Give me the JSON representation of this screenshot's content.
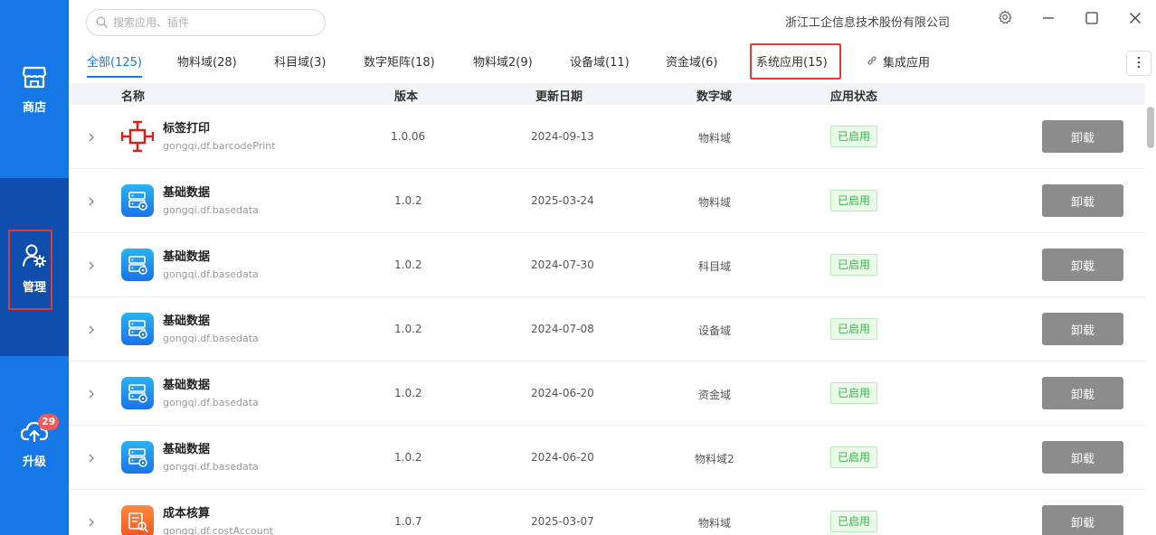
{
  "search": {
    "placeholder": "搜索应用、插件"
  },
  "header": {
    "company": "浙江工企信息技术股份有限公司"
  },
  "sidebar": {
    "items": [
      {
        "label": "商店",
        "icon": "store-icon"
      },
      {
        "label": "管理",
        "icon": "user-gear-icon"
      },
      {
        "label": "升级",
        "icon": "cloud-upload-icon",
        "badge": "29"
      }
    ]
  },
  "tabs": [
    {
      "label": "全部(125)"
    },
    {
      "label": "物料域(28)"
    },
    {
      "label": "科目域(3)"
    },
    {
      "label": "数字矩阵(18)"
    },
    {
      "label": "物料域2(9)"
    },
    {
      "label": "设备域(11)"
    },
    {
      "label": "资金域(6)"
    },
    {
      "label": "系统应用(15)"
    },
    {
      "label": "集成应用",
      "icon": "link-icon"
    }
  ],
  "table": {
    "columns": [
      "名称",
      "版本",
      "更新日期",
      "数字域",
      "应用状态"
    ],
    "rows": [
      {
        "name": "标签打印",
        "id": "gongqi.df.barcodePrint",
        "version": "1.0.06",
        "date": "2024-09-13",
        "domain": "物料域",
        "status": "已启用",
        "action": "卸载",
        "icon": "barcode-print-icon"
      },
      {
        "name": "基础数据",
        "id": "gongqi.df.basedata",
        "version": "1.0.2",
        "date": "2025-03-24",
        "domain": "物料域",
        "status": "已启用",
        "action": "卸载",
        "icon": "basedata-icon"
      },
      {
        "name": "基础数据",
        "id": "gongqi.df.basedata",
        "version": "1.0.2",
        "date": "2024-07-30",
        "domain": "科目域",
        "status": "已启用",
        "action": "卸载",
        "icon": "basedata-icon"
      },
      {
        "name": "基础数据",
        "id": "gongqi.df.basedata",
        "version": "1.0.2",
        "date": "2024-07-08",
        "domain": "设备域",
        "status": "已启用",
        "action": "卸载",
        "icon": "basedata-icon"
      },
      {
        "name": "基础数据",
        "id": "gongqi.df.basedata",
        "version": "1.0.2",
        "date": "2024-06-20",
        "domain": "资金域",
        "status": "已启用",
        "action": "卸载",
        "icon": "basedata-icon"
      },
      {
        "name": "基础数据",
        "id": "gongqi.df.basedata",
        "version": "1.0.2",
        "date": "2024-06-20",
        "domain": "物料域2",
        "status": "已启用",
        "action": "卸载",
        "icon": "basedata-icon"
      },
      {
        "name": "成本核算",
        "id": "gongqi.df.costAccount",
        "version": "1.0.7",
        "date": "2025-03-07",
        "domain": "物料域",
        "status": "已启用",
        "action": "卸载",
        "icon": "cost-account-icon"
      }
    ]
  },
  "colors": {
    "accent": "#1677e6",
    "sidebar_active": "#0e4fae",
    "highlight_border": "#e53935",
    "status_green": "#3bb24a",
    "button_gray": "#8c8c8c"
  }
}
